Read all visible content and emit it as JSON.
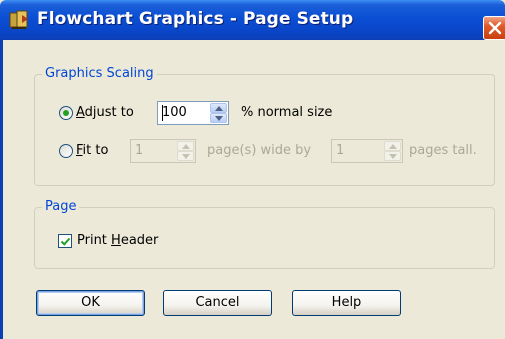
{
  "window": {
    "title": "Flowchart Graphics - Page Setup"
  },
  "scaling": {
    "group_label": "Graphics Scaling",
    "adjust_prefix": "",
    "adjust_mnemonic": "A",
    "adjust_rest": "djust to",
    "adjust_value": "100",
    "adjust_suffix": "% normal size",
    "fit_mnemonic": "F",
    "fit_rest": "it to",
    "fit_wide_value": "1",
    "fit_wide_suffix": "page(s) wide by",
    "fit_tall_value": "1",
    "fit_tall_suffix": "pages tall.",
    "selected": "adjust"
  },
  "page": {
    "group_label": "Page",
    "print_header_prefix": "Print ",
    "print_header_mnemonic": "H",
    "print_header_rest": "eader",
    "print_header_checked": true
  },
  "buttons": {
    "ok": "OK",
    "cancel": "Cancel",
    "help": "Help"
  },
  "colors": {
    "title_bar": "#0a4ed4",
    "group_label": "#0046d5",
    "radio_dot": "#21a121",
    "close_button": "#e05a2c"
  },
  "icons": {
    "app": "flowchart-app-icon",
    "close": "close-icon",
    "spin_up": "spin-up-arrow-icon",
    "spin_down": "spin-down-arrow-icon",
    "check": "checkmark-icon"
  }
}
